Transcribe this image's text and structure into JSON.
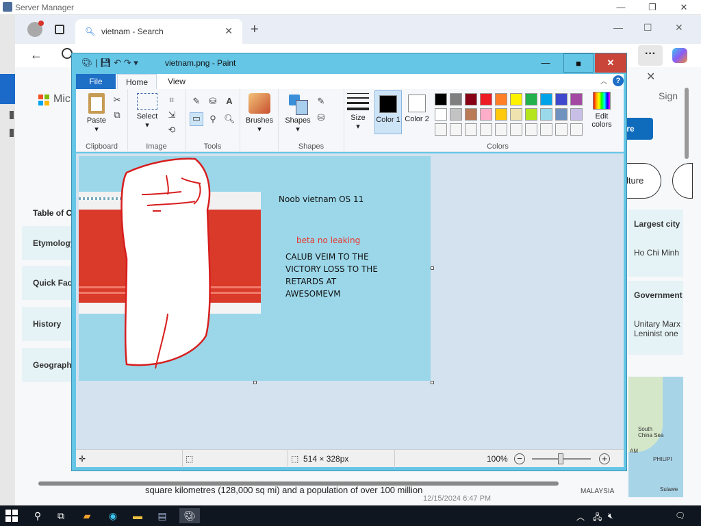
{
  "server_manager": {
    "title": "Server Manager"
  },
  "browser": {
    "tab_title": "vietnam - Search",
    "new_tab_symbol": "+",
    "tab_close_symbol": "✕",
    "more_label": "···",
    "page": {
      "brand_fragment": "Mic",
      "sign_in_fragment": "Sign",
      "button_fragment": "ore",
      "toc_title": "Table of C",
      "toc_items": [
        "Etymology",
        "Quick Fact",
        "History",
        "Geography"
      ],
      "culture_fragment": "lture",
      "info": [
        {
          "heading": "Largest city",
          "value": "Ho Chi Minh"
        },
        {
          "heading": "Government",
          "value": "Unitary Marx Leninist one"
        }
      ],
      "map_labels": {
        "sea": "South China Sea",
        "am": "AM",
        "philippines": "PHILIPI",
        "malaysia": "MALAYSIA",
        "sulawesi": "Sulawe"
      },
      "footer_text": "square kilometres (128,000 sq mi) and a population of over 100 million",
      "footer_date": "12/15/2024 6:47 PM"
    }
  },
  "paint": {
    "title": "vietnam.png - Paint",
    "tabs": {
      "file": "File",
      "home": "Home",
      "view": "View"
    },
    "groups": {
      "clipboard": "Clipboard",
      "image": "Image",
      "tools": "Tools",
      "shapes": "Shapes",
      "colors": "Colors"
    },
    "buttons": {
      "paste": "Paste",
      "select": "Select",
      "brushes": "Brushes",
      "shapes": "Shapes",
      "size": "Size",
      "color1": "Color 1",
      "color2": "Color 2",
      "edit_colors": "Edit colors"
    },
    "color1_value": "#000000",
    "color2_value": "#ffffff",
    "palette": [
      "#000000",
      "#7f7f7f",
      "#880015",
      "#ed1c24",
      "#ff7f27",
      "#fff200",
      "#22b14c",
      "#00a2e8",
      "#3f48cc",
      "#a349a4",
      "#ffffff",
      "#c3c3c3",
      "#b97a57",
      "#ffaec9",
      "#ffc90e",
      "#efe4b0",
      "#b5e61d",
      "#99d9ea",
      "#7092be",
      "#c8bfe7",
      "#f5f5f5",
      "#f5f5f5",
      "#f5f5f5",
      "#f5f5f5",
      "#f5f5f5",
      "#f5f5f5",
      "#f5f5f5",
      "#f5f5f5",
      "#f5f5f5",
      "#f5f5f5"
    ],
    "canvas": {
      "heading": "Noob vietnam OS 11",
      "subheading": "beta no leaking",
      "lines": [
        "CALUB VEIM TO THE",
        "VICTORY LOSS TO THE",
        "RETARDS AT",
        "AWESOMEVM"
      ]
    },
    "status": {
      "dimensions": "514 × 328px",
      "zoom": "100%"
    }
  }
}
